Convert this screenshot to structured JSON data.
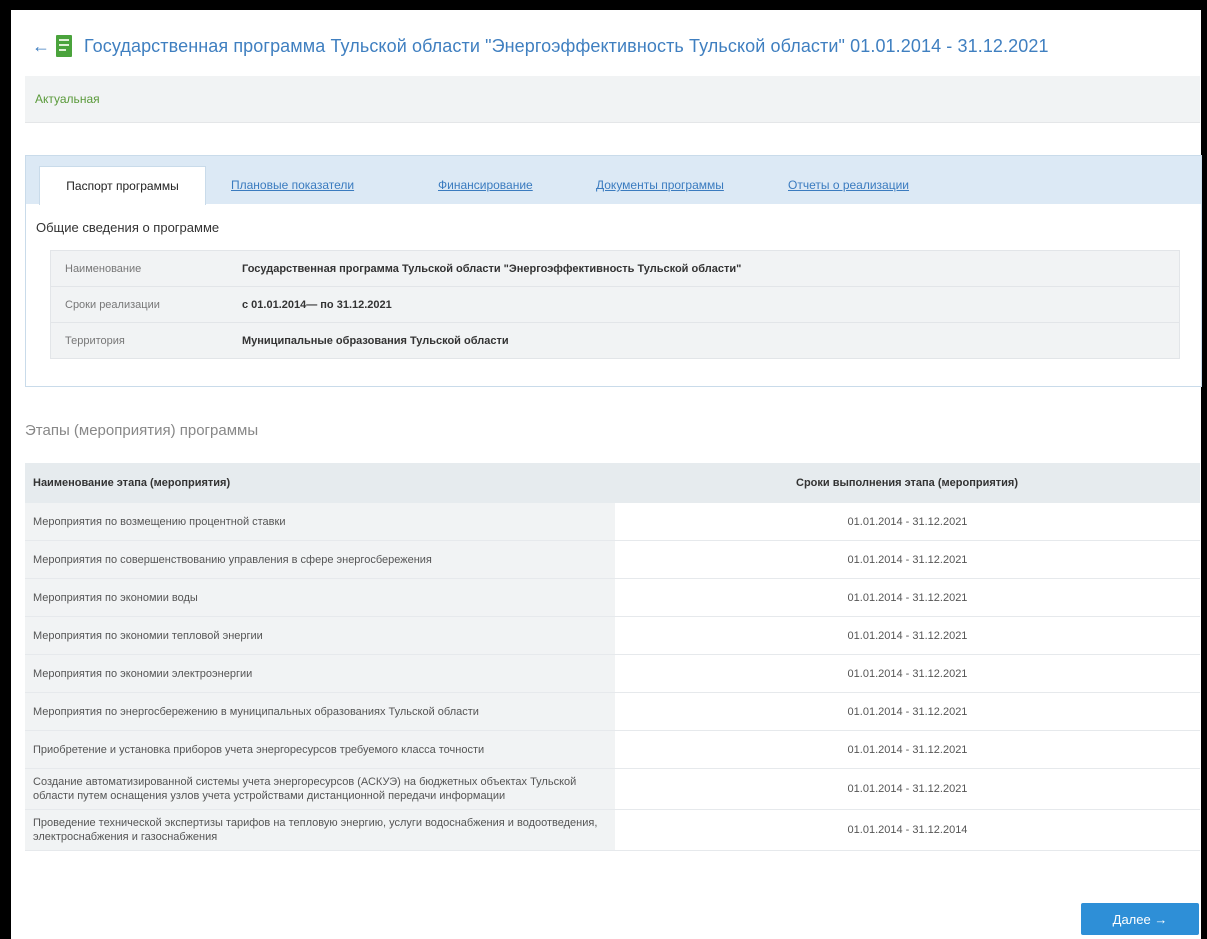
{
  "header": {
    "title": "Государственная программа Тульской области \"Энергоэффективность Тульской области\" 01.01.2014 - 31.12.2021"
  },
  "status": {
    "label": "Актуальная"
  },
  "tabs": [
    {
      "label": "Паспорт программы",
      "active": true
    },
    {
      "label": "Плановые показатели",
      "active": false
    },
    {
      "label": "Финансирование",
      "active": false
    },
    {
      "label": "Документы программы",
      "active": false
    },
    {
      "label": "Отчеты о реализации",
      "active": false
    }
  ],
  "passport": {
    "section_title": "Общие сведения о программе",
    "fields": [
      {
        "label": "Наименование",
        "value": "Государственная программа Тульской области \"Энергоэффективность Тульской области\""
      },
      {
        "label": "Сроки реализации",
        "value": "с 01.01.2014— по 31.12.2021"
      },
      {
        "label": "Территория",
        "value": "Муниципальные образования Тульской области"
      }
    ]
  },
  "stages": {
    "title": "Этапы (мероприятия) программы",
    "columns": [
      "Наименование этапа (мероприятия)",
      "Сроки выполнения этапа (мероприятия)"
    ],
    "rows": [
      {
        "name": "Мероприятия по возмещению процентной ставки",
        "dates": "01.01.2014 - 31.12.2021"
      },
      {
        "name": "Мероприятия по совершенствованию управления в сфере энергосбережения",
        "dates": "01.01.2014 - 31.12.2021"
      },
      {
        "name": "Мероприятия по экономии воды",
        "dates": "01.01.2014 - 31.12.2021"
      },
      {
        "name": "Мероприятия по экономии тепловой энергии",
        "dates": "01.01.2014 - 31.12.2021"
      },
      {
        "name": "Мероприятия по экономии электроэнергии",
        "dates": "01.01.2014 - 31.12.2021"
      },
      {
        "name": "Мероприятия по энергосбережению в муниципальных образованиях Тульской области",
        "dates": "01.01.2014 - 31.12.2021"
      },
      {
        "name": "Приобретение и установка приборов учета энергоресурсов требуемого класса точности",
        "dates": "01.01.2014 - 31.12.2021"
      },
      {
        "name": "Создание автоматизированной системы учета энергоресурсов (АСКУЭ) на бюджетных объектах Тульской области путем оснащения узлов учета устройствами дистанционной передачи информации",
        "dates": "01.01.2014 - 31.12.2021"
      },
      {
        "name": "Проведение технической экспертизы тарифов на тепловую энергию, услуги водоснабжения и водоотведения, электроснабжения и газоснабжения",
        "dates": "01.01.2014 - 31.12.2014"
      }
    ]
  },
  "footer": {
    "next_label": "Далее →"
  }
}
